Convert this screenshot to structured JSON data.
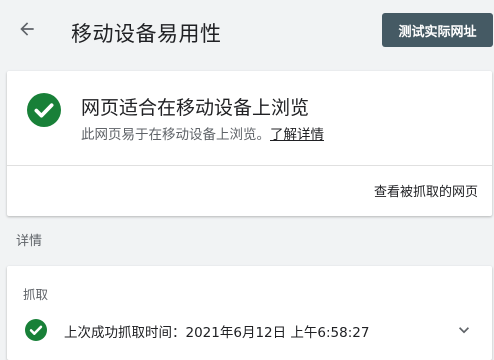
{
  "header": {
    "title": "移动设备易用性",
    "test_button_label": "测试实际网址"
  },
  "result": {
    "title": "网页适合在移动设备上浏览",
    "subtitle": "此网页易于在移动设备上浏览。",
    "learn_more_label": "了解详情",
    "view_crawled_label": "查看被抓取的网页",
    "status_color": "#188038"
  },
  "details": {
    "section_label": "详情",
    "crawl": {
      "heading": "抓取",
      "last_crawl_label": "上次成功抓取时间：",
      "last_crawl_value": "2021年6月12日 上午6:58:27"
    }
  },
  "icons": {
    "back": "arrow-back-icon",
    "status": "check-circle-icon",
    "expand": "chevron-down-icon"
  }
}
